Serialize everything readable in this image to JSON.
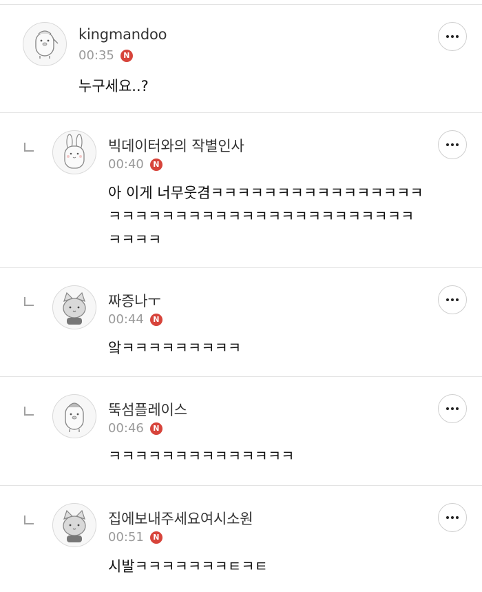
{
  "comments": [
    {
      "username": "kingmandoo",
      "time": "00:35",
      "badge": "N",
      "body": "누구세요..?",
      "avatar": "penguin-character-avatar"
    },
    {
      "username": "빅데이터와의 작별인사",
      "time": "00:40",
      "badge": "N",
      "body_lines": [
        "아 이게 너무웃겸ㅋㅋㅋㅋㅋㅋㅋㅋㅋㅋㅋㅋㅋㅋㅋㅋ",
        "ㅋㅋㅋㅋㅋㅋㅋㅋㅋㅋㅋㅋㅋㅋㅋㅋㅋㅋㅋㅋㅋㅋㅋ",
        "ㅋㅋㅋㅋ"
      ],
      "avatar": "rabbit-character-avatar"
    },
    {
      "username": "짜증나ㅜ",
      "time": "00:44",
      "badge": "N",
      "body": "앜ㅋㅋㅋㅋㅋㅋㅋㅋㅋ",
      "avatar": "cat-character-avatar"
    },
    {
      "username": "뚝섬플레이스",
      "time": "00:46",
      "badge": "N",
      "body": "ㅋㅋㅋㅋㅋㅋㅋㅋㅋㅋㅋㅋㅋㅋ",
      "avatar": "penguin-character-avatar"
    },
    {
      "username": "집에보내주세요여시소원",
      "time": "00:51",
      "badge": "N",
      "body": "시발ㅋㅋㅋㅋㅋㅋㅋㅌㅋㅌ",
      "avatar": "cat-character-avatar"
    }
  ]
}
